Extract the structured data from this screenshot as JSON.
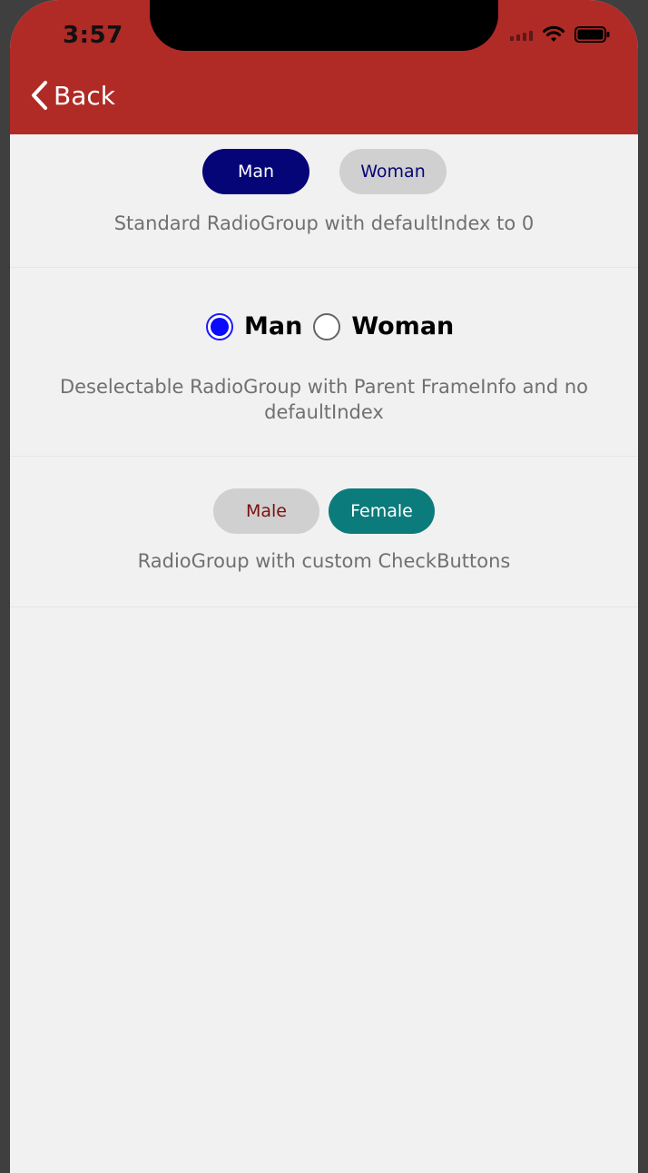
{
  "status_bar": {
    "time": "3:57"
  },
  "nav": {
    "back_label": "Back"
  },
  "section1": {
    "options": [
      "Man",
      "Woman"
    ],
    "caption": "Standard RadioGroup with defaultIndex to 0"
  },
  "section2": {
    "options": [
      "Man",
      "Woman"
    ],
    "caption": "Deselectable RadioGroup with Parent FrameInfo and no defaultIndex"
  },
  "section3": {
    "options": [
      "Male",
      "Female"
    ],
    "caption": "RadioGroup with custom CheckButtons"
  },
  "colors": {
    "header": "#b02a26",
    "navy": "#050578",
    "teal": "#0c7b7b",
    "radio_blue": "#0a0aff",
    "pill_gray": "#d0d0d0",
    "male_text": "#7a1010"
  }
}
